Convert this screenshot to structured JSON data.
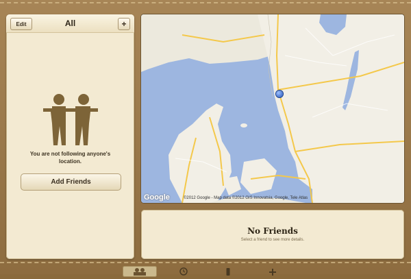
{
  "left_panel": {
    "edit_label": "Edit",
    "title": "All",
    "add_symbol": "+",
    "empty_message": "You are not following anyone's location.",
    "add_friends_label": "Add Friends"
  },
  "map": {
    "logo": "Google",
    "attribution": "©2012 Google - Map data ©2012 GIS Innovatsia, Google, Tele Atlas"
  },
  "info_panel": {
    "title": "No Friends",
    "subtitle": "Select a friend to see more details."
  },
  "toolbar": {
    "items": [
      "friends-icon",
      "clock-icon",
      "phone-icon",
      "plus-icon"
    ]
  },
  "colors": {
    "leather": "#8d6c3f",
    "paper": "#f3ead2",
    "icon_brown": "#7d6438",
    "water": "#9db6e0",
    "land": "#f2efe6",
    "road": "#f4c84a"
  }
}
